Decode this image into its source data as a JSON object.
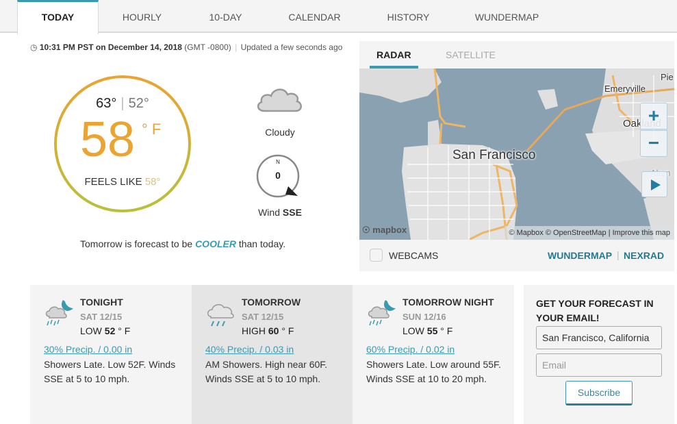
{
  "tabs": [
    {
      "label": "TODAY",
      "active": true
    },
    {
      "label": "HOURLY"
    },
    {
      "label": "10-DAY"
    },
    {
      "label": "CALENDAR"
    },
    {
      "label": "HISTORY"
    },
    {
      "label": "WUNDERMAP"
    }
  ],
  "timestamp": {
    "icon": "clock-icon",
    "time": "10:31 PM PST on December 14, 2018",
    "offset": "(GMT -0800)",
    "separator": "|",
    "updated": "Updated a few seconds ago"
  },
  "current": {
    "high": "63°",
    "low": "52°",
    "temp": "58",
    "unit": "° F",
    "feels_like_label": "FEELS LIKE",
    "feels_like_value": "58°",
    "condition": "Cloudy",
    "condition_icon": "cloud-icon",
    "wind_speed": "0",
    "wind_north": "N",
    "wind_label": "Wind",
    "wind_dir": "SSE",
    "gauge_colors": {
      "top": "#eba331",
      "bottom": "#b8c03a"
    }
  },
  "tomorrow_note": {
    "prefix": "Tomorrow is forecast to be",
    "emphasis": "COOLER",
    "suffix": "than today."
  },
  "map": {
    "tabs": [
      {
        "label": "RADAR",
        "active": true
      },
      {
        "label": "SATELLITE"
      }
    ],
    "labels": {
      "city": "San Francisco",
      "emeryville": "Emeryville",
      "oakland": "Oakland",
      "piedmont": "Pie",
      "alameda": "Alam"
    },
    "zoom_in": "+",
    "zoom_out": "−",
    "logo": "mapbox",
    "attribution": "© Mapbox © OpenStreetMap | Improve this map",
    "webcams_label": "WEBCAMS",
    "webcams_checked": false,
    "links": [
      {
        "label": "WUNDERMAP"
      },
      {
        "label": "NEXRAD"
      }
    ],
    "link_separator": "|"
  },
  "forecast": [
    {
      "title": "TONIGHT",
      "date": "SAT 12/15",
      "temp_label": "LOW",
      "temp": "52",
      "unit": "° F",
      "precip": "30% Precip. / 0.00 in",
      "desc": "Showers Late. Low 52F. Winds SSE at 5 to 10 mph.",
      "icon": "night-showers-icon"
    },
    {
      "title": "TOMORROW",
      "date": "SAT 12/15",
      "temp_label": "HIGH",
      "temp": "60",
      "unit": "° F",
      "precip": "40% Precip. / 0.03 in",
      "desc": "AM Showers. High near 60F. Winds SSE at 5 to 10 mph.",
      "icon": "rain-icon"
    },
    {
      "title": "TOMORROW NIGHT",
      "date": "SUN 12/16",
      "temp_label": "LOW",
      "temp": "55",
      "unit": "° F",
      "precip": "60% Precip. / 0.02 in",
      "desc": "Showers Late. Low around 55F. Winds SSE at 10 to 20 mph.",
      "icon": "night-showers-icon"
    }
  ],
  "email_signup": {
    "heading": "GET YOUR FORECAST IN YOUR EMAIL!",
    "location_value": "San Francisco, California",
    "email_placeholder": "Email",
    "button": "Subscribe"
  }
}
